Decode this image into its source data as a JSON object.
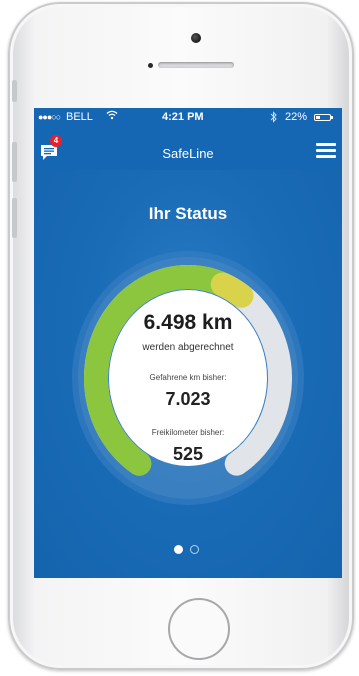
{
  "status_bar": {
    "signal": "●●●○○",
    "carrier": "BELL",
    "wifi_icon": "wifi-icon",
    "time": "4:21 PM",
    "bluetooth_icon": "bluetooth-icon",
    "battery_percent": "22%",
    "battery_level": 0.22
  },
  "navbar": {
    "title": "SafeLine",
    "messages_badge": "4",
    "messages_icon": "chat-icon",
    "menu_icon": "hamburger-menu-icon"
  },
  "main": {
    "title": "Ihr Status",
    "billed_km": "6.498 km",
    "billed_label": "werden abgerechnet",
    "driven_label": "Gefahrene km bisher:",
    "driven_km": "7.023",
    "free_label": "Freikilometer bisher:",
    "free_km": "525",
    "gauge_fraction_green": 0.58,
    "gauge_fraction_yellow": 0.04
  },
  "pager": {
    "pages": 2,
    "active_index": 0
  },
  "colors": {
    "screen_bg": "#1667b3",
    "gauge_green": "#8cc63f",
    "gauge_yellow": "#d8d34a",
    "gauge_track": "#e1e4e8",
    "badge_red": "#e5222c"
  }
}
